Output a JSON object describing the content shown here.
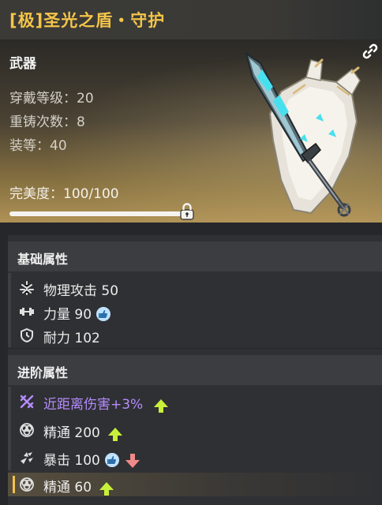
{
  "item": {
    "title": "[极]圣光之盾・守护",
    "category": "武器",
    "stats": [
      {
        "label": "穿戴等级：20"
      },
      {
        "label": "重铸次数：8"
      },
      {
        "label": "装等：40"
      }
    ],
    "perfection_label": "完美度：100/100",
    "perfection_value": 100,
    "perfection_max": 100
  },
  "base_section": {
    "title": "基础属性",
    "rows": [
      {
        "icon": "sword-burst-icon",
        "label": "物理攻击 50"
      },
      {
        "icon": "dumbbell-icon",
        "label": "力量 90"
      },
      {
        "icon": "shield-clock-icon",
        "label": "耐力 102"
      }
    ]
  },
  "advanced_section": {
    "title": "进阶属性",
    "rows": [
      {
        "icon": "crossed-swords-icon",
        "label": "近距离伤害+3%"
      },
      {
        "icon": "mastery-rings-icon",
        "label": "精通 200"
      },
      {
        "icon": "crit-burst-icon",
        "label": "暴击 100"
      },
      {
        "icon": "mastery-rings-icon",
        "label": "精通 60"
      }
    ]
  },
  "colors": {
    "title_gold": "#f4c54a",
    "purple": "#b58cff",
    "up_arrow": "#c8f03a",
    "down_arrow": "#f08a8a"
  }
}
